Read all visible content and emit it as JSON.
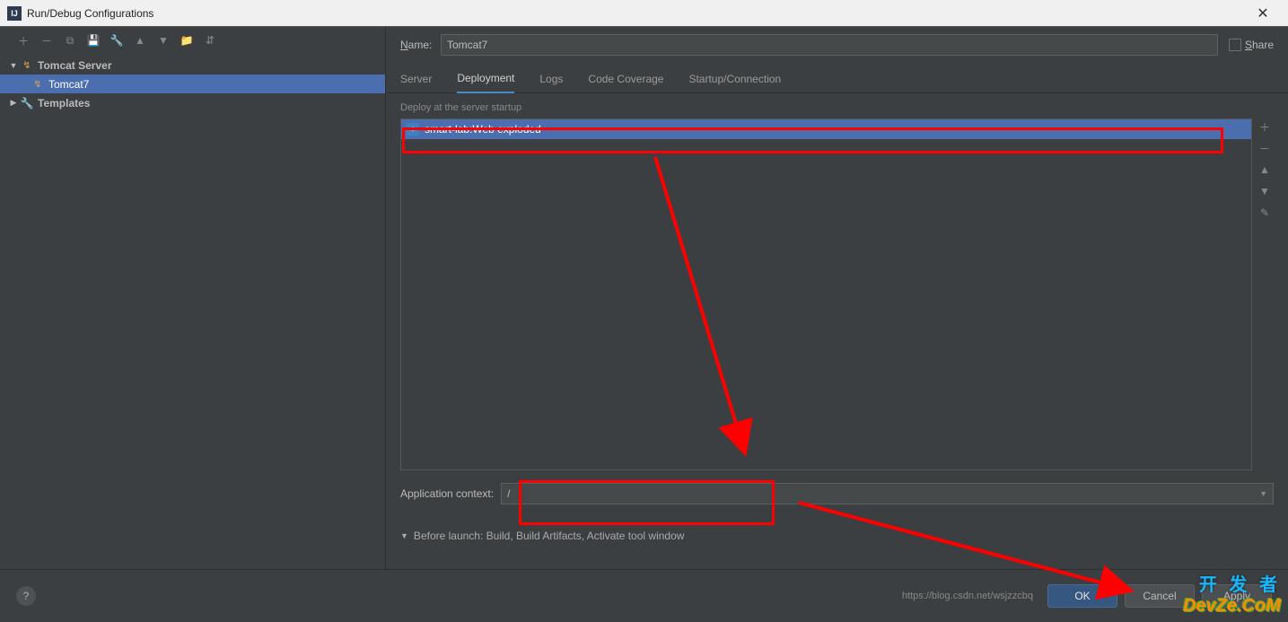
{
  "window": {
    "title": "Run/Debug Configurations"
  },
  "form": {
    "name_label": "Name:",
    "name_value": "Tomcat7",
    "share_label": "Share"
  },
  "tree": {
    "root": {
      "label": "Tomcat Server"
    },
    "child": {
      "label": "Tomcat7"
    },
    "templates": {
      "label": "Templates"
    }
  },
  "tabs": {
    "server": "Server",
    "deployment": "Deployment",
    "logs": "Logs",
    "coverage": "Code Coverage",
    "startup": "Startup/Connection"
  },
  "deployment": {
    "section_label": "Deploy at the server startup",
    "items": [
      "smart-lab:Web exploded"
    ],
    "context_label": "Application context:",
    "context_value": "/"
  },
  "before_launch": {
    "label": "Before launch: Build, Build Artifacts, Activate tool window"
  },
  "buttons": {
    "ok": "OK",
    "cancel": "Cancel",
    "apply": "Apply"
  },
  "footer": {
    "url": "https://blog.csdn.net/wsjzzcbq"
  },
  "watermark": {
    "line1": "开 发 者",
    "line2": "DevZe.CoM"
  },
  "name_underline_char": "N",
  "share_underline_char": "S",
  "before_underline_char": "B"
}
